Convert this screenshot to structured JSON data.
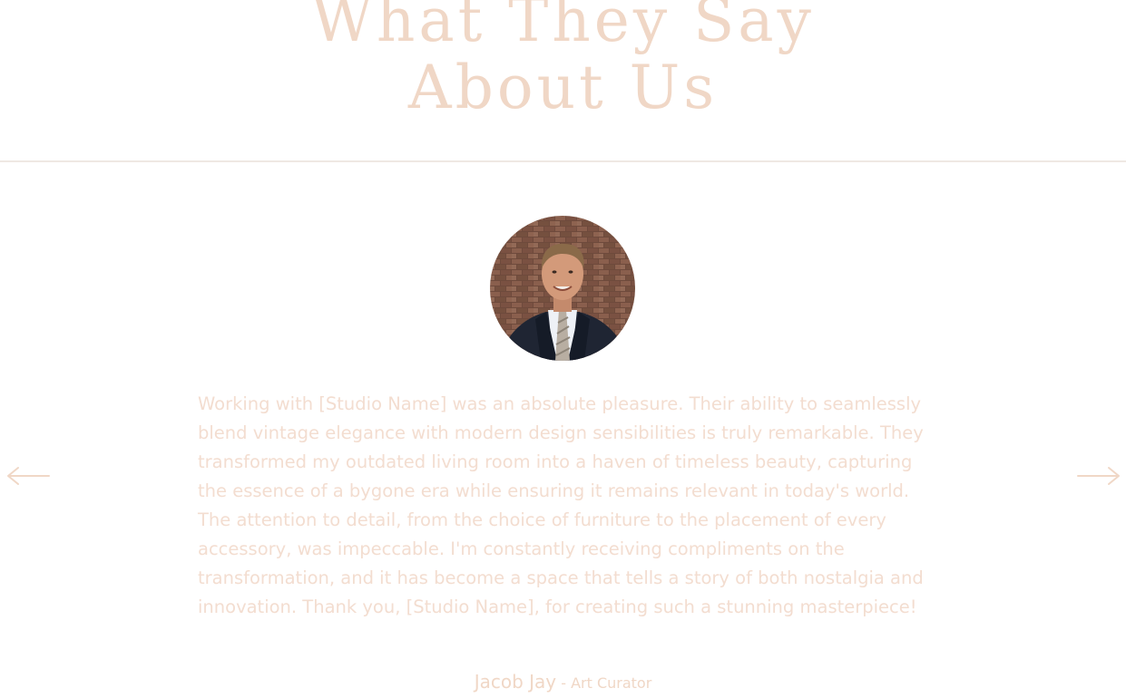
{
  "heading": {
    "line1": "What They Say",
    "line2": "About Us"
  },
  "testimonial": {
    "quote": "Working with [Studio Name] was an absolute pleasure. Their ability to seamlessly blend vintage elegance with modern design sensibilities is truly remarkable. They transformed my outdated living room into a haven of timeless beauty, capturing the essence of a bygone era while ensuring it remains relevant in today's world. The attention to detail, from the choice of furniture to the placement of every accessory, was impeccable. I'm constantly receiving compliments on the transformation, and it has become a space that tells a story of both nostalgia and innovation. Thank you, [Studio Name], for creating such a stunning masterpiece!",
    "author_name": "Jacob Jay",
    "separator": " - ",
    "author_role": "Art Curator"
  },
  "navigation": {
    "prev_icon": "arrow-left-icon",
    "next_icon": "arrow-right-icon"
  },
  "colors": {
    "accent": "#f0d7c6",
    "quote_text": "#f3ddd0",
    "divider": "#efe8e3",
    "background": "#ffffff"
  }
}
